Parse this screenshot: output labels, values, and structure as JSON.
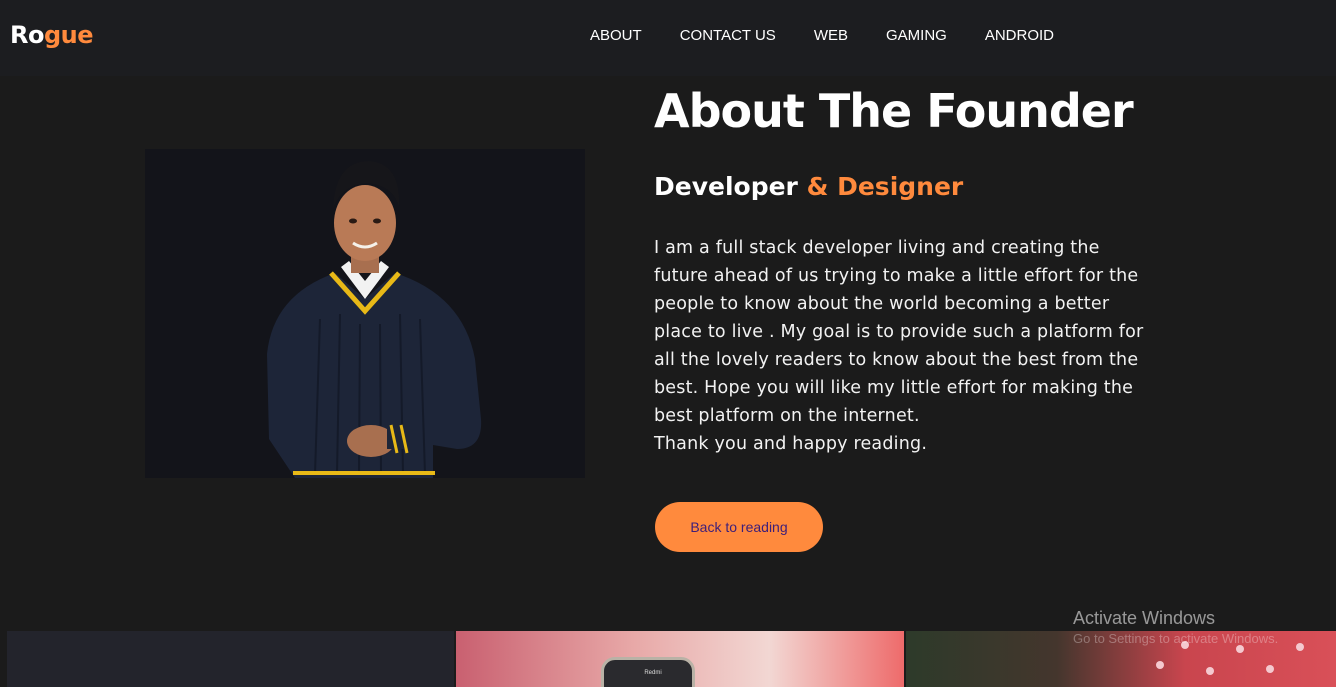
{
  "header": {
    "logo_part1": "Ro",
    "logo_part2": "gue",
    "nav": [
      "ABOUT",
      "CONTACT US",
      "WEB",
      "GAMING",
      "ANDROID"
    ]
  },
  "about": {
    "title": "About The Founder",
    "subtitle_part1": "Developer",
    "subtitle_part2": " & Designer",
    "bio": "I am a full stack developer living and creating the\nfuture ahead of us trying to make a little effort for the\npeople to know about the world becoming a better\nplace to live . My goal is to provide such a platform for\nall the lovely readers to know about the best from the\nbest. Hope you will like my little effort for making the\nbest platform on the internet.\nThank you and happy reading.",
    "cta_label": "Back to reading"
  },
  "cards": {
    "phone_text": "Redmi"
  },
  "watermark": {
    "title": "Activate Windows",
    "subtitle": "Go to Settings to activate Windows."
  },
  "colors": {
    "accent": "#ff8a3d",
    "background": "#1b1b1b",
    "navbar": "#1c1d20",
    "cta_text": "#3c1e7a"
  },
  "icons": [
    "founder-portrait"
  ]
}
